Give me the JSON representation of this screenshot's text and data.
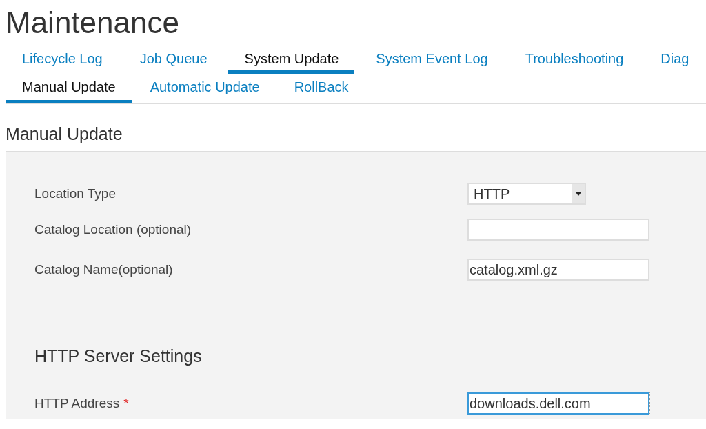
{
  "page": {
    "title": "Maintenance"
  },
  "tabs": [
    {
      "label": "Lifecycle Log",
      "selected": false
    },
    {
      "label": "Job Queue",
      "selected": false
    },
    {
      "label": "System Update",
      "selected": true
    },
    {
      "label": "System Event Log",
      "selected": false
    },
    {
      "label": "Troubleshooting",
      "selected": false
    },
    {
      "label": "Diag",
      "selected": false
    }
  ],
  "subtabs": [
    {
      "label": "Manual Update",
      "selected": true
    },
    {
      "label": "Automatic Update",
      "selected": false
    },
    {
      "label": "RollBack",
      "selected": false
    }
  ],
  "section": {
    "title": "Manual Update"
  },
  "fields": [
    {
      "kind": "select",
      "label": "Location Type",
      "value": "HTTP"
    },
    {
      "kind": "text",
      "label": "Catalog Location (optional)"
    },
    {
      "kind": "text",
      "label": "Catalog Name(optional)",
      "value": "catalog.xml.gz"
    }
  ],
  "http_settings": {
    "title": "HTTP Server Settings",
    "fields": [
      {
        "kind": "text",
        "label": "HTTP Address",
        "required_mark": "*",
        "value": "downloads.dell.com",
        "focused": true
      }
    ]
  }
}
